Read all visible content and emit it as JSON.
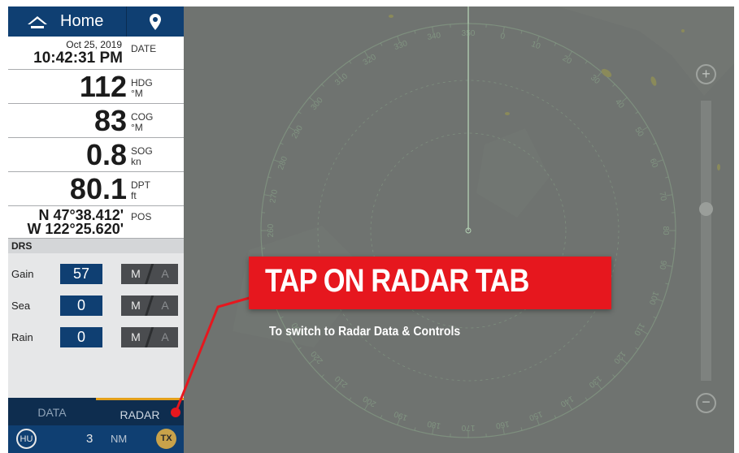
{
  "topbar": {
    "home_label": "Home",
    "home_icon": "home-icon",
    "pin_icon": "location-pin-icon"
  },
  "datetime": {
    "date": "Oct 25, 2019",
    "time": "10:42:31 PM",
    "caption": "DATE"
  },
  "heading": {
    "value": "112",
    "caption": "HDG",
    "unit": "°M"
  },
  "cog": {
    "value": "83",
    "caption": "COG",
    "unit": "°M"
  },
  "sog": {
    "value": "0.8",
    "caption": "SOG",
    "unit": "kn"
  },
  "depth": {
    "value": "80.1",
    "caption": "DPT",
    "unit": "ft"
  },
  "position": {
    "lat": "N 47°38.412'",
    "lon": "W 122°25.620'",
    "caption": "POS"
  },
  "drs": {
    "header": "DRS",
    "rows": [
      {
        "label": "Gain",
        "value": "57",
        "manual": "M",
        "auto": "A"
      },
      {
        "label": "Sea",
        "value": "0",
        "manual": "M",
        "auto": "A"
      },
      {
        "label": "Rain",
        "value": "0",
        "manual": "M",
        "auto": "A"
      }
    ]
  },
  "tabs": {
    "data": "DATA",
    "radar": "RADAR"
  },
  "bottom": {
    "mode": "HU",
    "range": "3",
    "range_unit": "NM",
    "tx": "TX"
  },
  "radar": {
    "bearing_labels": [
      "340",
      "350",
      "0",
      "10",
      "20",
      "30",
      "40",
      "50",
      "60",
      "70",
      "80",
      "90",
      "100",
      "110",
      "120",
      "130",
      "140",
      "150",
      "160",
      "170",
      "180",
      "190",
      "200",
      "210",
      "220",
      "230",
      "240",
      "250",
      "260",
      "270",
      "280",
      "290",
      "300",
      "310",
      "320",
      "330"
    ],
    "zoom_in": "+",
    "zoom_out": "−"
  },
  "annotation": {
    "title": "TAP ON RADAR TAB",
    "subtitle": "To switch to Radar Data & Controls",
    "color": "#e6171e"
  },
  "colors": {
    "navy": "#0f3f72",
    "accent": "#e4a11b",
    "radar_bg": "#6f7370"
  }
}
